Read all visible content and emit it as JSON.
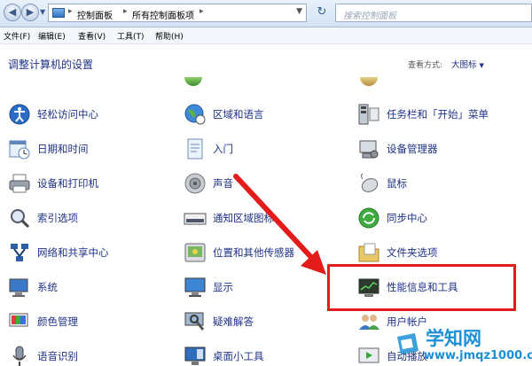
{
  "address_bar": {
    "crumbs": [
      "控制面板",
      "所有控制面板项"
    ],
    "search_placeholder": "搜索控制面板"
  },
  "menu": [
    "文件(F)",
    "编辑(E)",
    "查看(V)",
    "工具(T)",
    "帮助(H)"
  ],
  "header": {
    "title": "调整计算机的设置",
    "view_label": "查看方式:",
    "view_value": "大图标"
  },
  "items": {
    "col1": [
      "轻松访问中心",
      "日期和时间",
      "设备和打印机",
      "索引选项",
      "网络和共享中心",
      "系统",
      "颜色管理",
      "语音识别"
    ],
    "col2": [
      "区域和语言",
      "入门",
      "声音",
      "通知区域图标",
      "位置和其他传感器",
      "显示",
      "疑难解答",
      "桌面小工具"
    ],
    "col3": [
      "任务栏和「开始」菜单",
      "设备管理器",
      "鼠标",
      "同步中心",
      "文件夹选项",
      "性能信息和工具",
      "用户帐户",
      "自动播放"
    ]
  },
  "highlighted_item": "性能信息和工具",
  "colors": {
    "link": "#1e3287",
    "highlight": "#e31b1b",
    "watermark": "#1c8fd6"
  },
  "watermark": {
    "title": "学知网",
    "url": "www.jmqz1000.com"
  }
}
